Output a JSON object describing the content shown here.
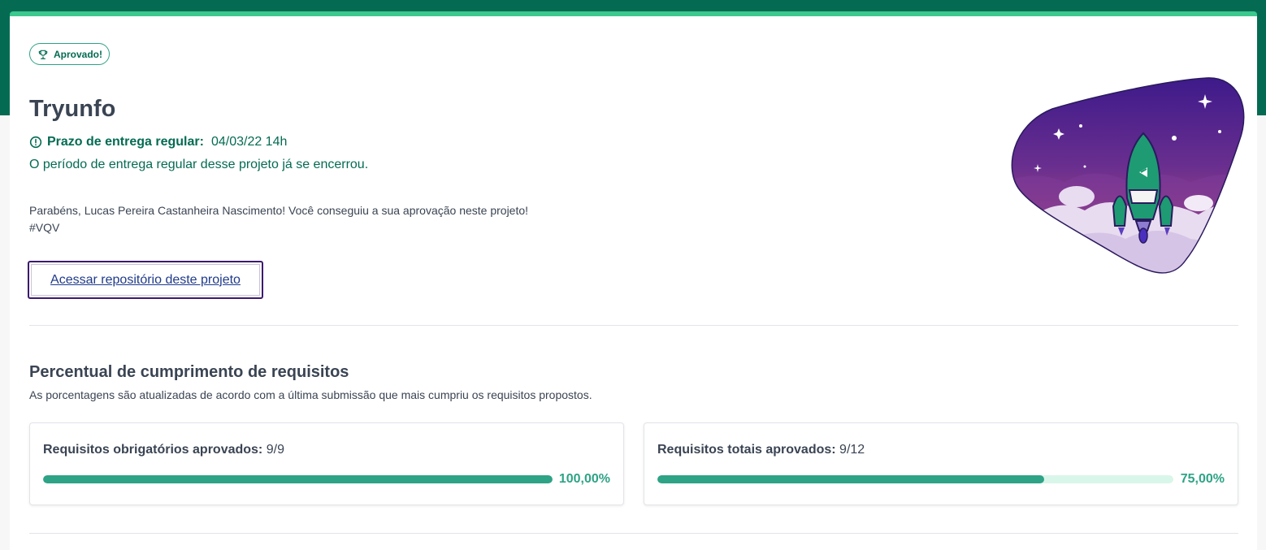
{
  "status_badge": {
    "label": "Aprovado!",
    "icon": "trophy-icon"
  },
  "project": {
    "title": "Tryunfo",
    "deadline_label": "Prazo de entrega regular:",
    "deadline_value": "04/03/22 14h",
    "deadline_icon": "alert-circle-icon",
    "closed_message": "O período de entrega regular desse projeto já se encerrou.",
    "congrats_line1": "Parabéns, Lucas Pereira Castanheira Nascimento! Você conseguiu a sua aprovação neste projeto!",
    "congrats_line2": "#VQV",
    "repo_link_label": "Acessar repositório deste projeto"
  },
  "requirements": {
    "title": "Percentual de cumprimento de requisitos",
    "subtitle": "As porcentagens são atualizadas de acordo com a última submissão que mais cumpriu os requisitos propostos.",
    "cards": [
      {
        "label": "Requisitos obrigatórios aprovados:",
        "value": "9/9",
        "percent_label": "100,00%",
        "fraction": 1.0
      },
      {
        "label": "Requisitos totais aprovados:",
        "value": "9/12",
        "percent_label": "75,00%",
        "fraction": 0.75
      }
    ]
  },
  "colors": {
    "brand_dark_green": "#046b52",
    "accent_green": "#3cc88e",
    "progress_green": "#2ea385",
    "progress_track": "#d9f6ea",
    "link_border_purple": "#3d1a6e"
  }
}
